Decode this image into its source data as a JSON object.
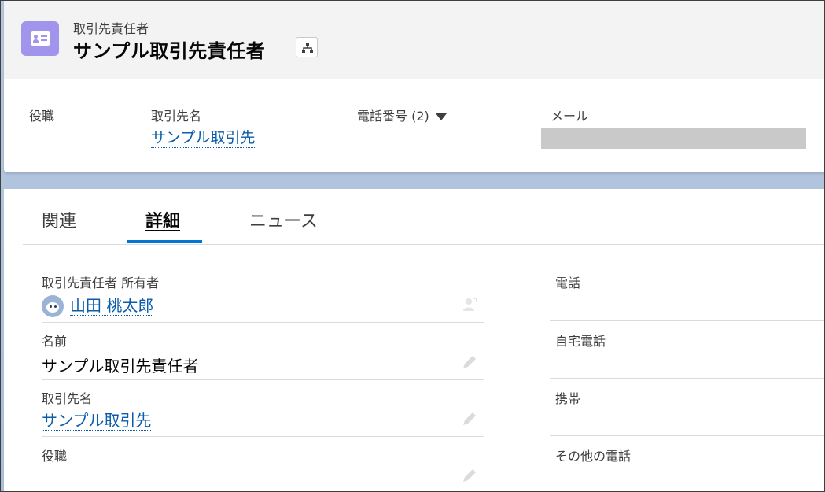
{
  "header": {
    "object_type": "取引先責任者",
    "record_title": "サンプル取引先責任者",
    "icon": "contact-card-icon",
    "hierarchy_icon": "hierarchy-icon"
  },
  "highlights": {
    "fields": [
      {
        "label": "役職",
        "value": ""
      },
      {
        "label": "取引先名",
        "value": "サンプル取引先"
      },
      {
        "label": "電話番号 (2)",
        "value": ""
      },
      {
        "label": "メール",
        "value": ""
      }
    ]
  },
  "tabs": [
    {
      "label": "関連",
      "active": false
    },
    {
      "label": "詳細",
      "active": true
    },
    {
      "label": "ニュース",
      "active": false
    }
  ],
  "details": {
    "left": [
      {
        "label": "取引先責任者 所有者",
        "value": "山田 桃太郎",
        "link": true
      },
      {
        "label": "名前",
        "value": "サンプル取引先責任者",
        "link": false
      },
      {
        "label": "取引先名",
        "value": "サンプル取引先",
        "link": true
      },
      {
        "label": "役職",
        "value": "",
        "link": false
      }
    ],
    "right": [
      {
        "label": "電話",
        "value": ""
      },
      {
        "label": "自宅電話",
        "value": ""
      },
      {
        "label": "携帯",
        "value": ""
      },
      {
        "label": "その他の電話",
        "value": ""
      }
    ]
  },
  "colors": {
    "brand_link": "#0b5cab",
    "tab_active": "#0176d3",
    "contact_icon_bg": "#a094ed"
  }
}
